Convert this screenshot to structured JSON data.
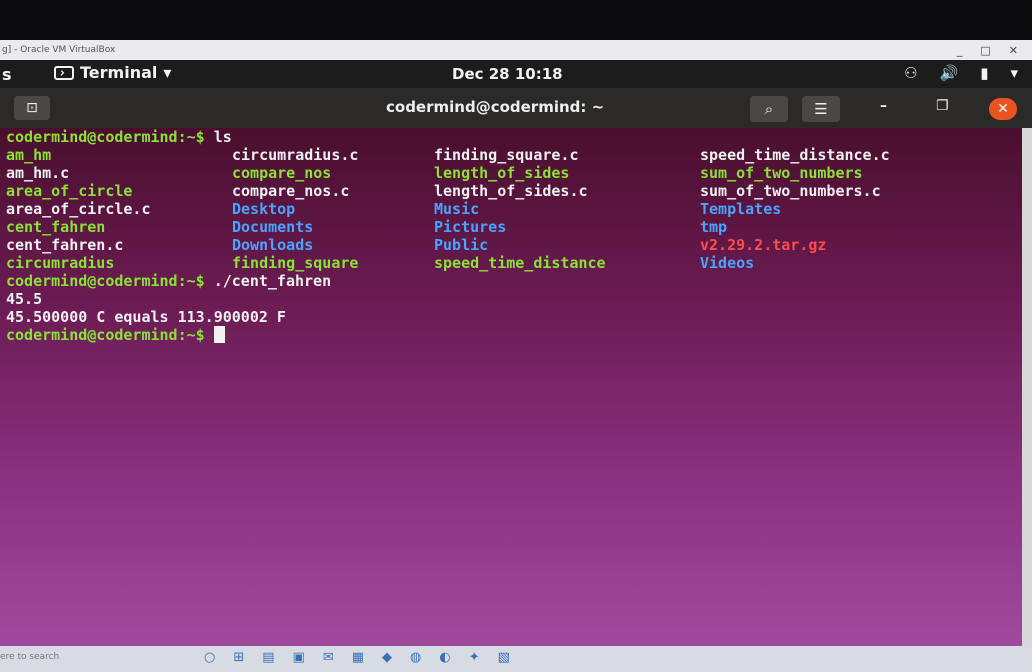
{
  "vbox": {
    "title": "g] - Oracle VM VirtualBox",
    "min": "_",
    "max": "□",
    "close": "✕"
  },
  "panel": {
    "activities": "s",
    "app_name": "Terminal",
    "app_caret": "▾",
    "clock": "Dec 28  10:18",
    "network_icon": "⚇",
    "volume_icon": "🔊",
    "battery_icon": "▮",
    "menu_caret": "▾"
  },
  "window": {
    "title": "codermind@codermind: ~",
    "newtab_icon": "⊡",
    "search_icon": "⌕",
    "menu_icon": "☰",
    "minimize": "–",
    "restore": "❐",
    "close": "✕"
  },
  "terminal": {
    "prompt": "codermind@codermind:~$",
    "cmd1": " ls",
    "ls_columns": [
      [
        "am_hm",
        "am_hm.c",
        "area_of_circle",
        "area_of_circle.c",
        "cent_fahren",
        "cent_fahren.c",
        "circumradius"
      ],
      [
        "circumradius.c",
        "compare_nos",
        "compare_nos.c",
        "Desktop",
        "Documents",
        "Downloads",
        "finding_square"
      ],
      [
        "finding_square.c",
        "length_of_sides",
        "length_of_sides.c",
        "Music",
        "Pictures",
        "Public",
        "speed_time_distance"
      ],
      [
        "speed_time_distance.c",
        "sum_of_two_numbers",
        "sum_of_two_numbers.c",
        "Templates",
        "tmp",
        "v2.29.2.tar.gz",
        "Videos"
      ]
    ],
    "ls_types": [
      [
        "exec",
        "plain",
        "exec",
        "plain",
        "exec",
        "plain",
        "exec"
      ],
      [
        "plain",
        "exec",
        "plain",
        "dir",
        "dir",
        "dir",
        "exec"
      ],
      [
        "plain",
        "exec",
        "plain",
        "dir",
        "dir",
        "dir",
        "exec"
      ],
      [
        "plain",
        "exec",
        "plain",
        "dir",
        "dir",
        "arch",
        "dir"
      ]
    ],
    "cmd2": " ./cent_fahren",
    "input_value": "45.5",
    "output": "45.500000 C equals 113.900002 F"
  },
  "taskbar": {
    "search_placeholder": "ere to search",
    "icons": [
      "○",
      "⊞",
      "▤",
      "▣",
      "✉",
      "▦",
      "◆",
      "◍",
      "◐",
      "✦",
      "▧"
    ]
  },
  "colors": {
    "prompt": "#8ae234",
    "directory": "#4aa3ff",
    "archive": "#ff4b4b",
    "accent": "#e95420"
  }
}
